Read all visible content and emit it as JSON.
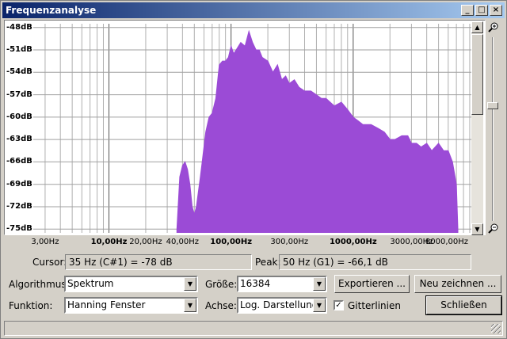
{
  "window": {
    "title": "Frequenzanalyse"
  },
  "titlebar_buttons": {
    "minimize": "_",
    "maximize": "□",
    "close": "×"
  },
  "colors": {
    "spectrum": "#9b4bd6",
    "title_start": "#0a246a",
    "title_end": "#a6caf0"
  },
  "plot": {
    "y_ticks": [
      "-48dB",
      "-51dB",
      "-54dB",
      "-57dB",
      "-60dB",
      "-63dB",
      "-66dB",
      "-69dB",
      "-72dB",
      "-75dB"
    ],
    "x_ticks": [
      {
        "label": "3,00Hz",
        "bold": false
      },
      {
        "label": "10,00Hz",
        "bold": true
      },
      {
        "label": "20,00Hz",
        "bold": false
      },
      {
        "label": "40,00Hz",
        "bold": false
      },
      {
        "label": "100,00Hz",
        "bold": true
      },
      {
        "label": "300,00Hz",
        "bold": false
      },
      {
        "label": "1000,00Hz",
        "bold": true
      },
      {
        "label": "3000,00Hz",
        "bold": false
      },
      {
        "label": "8000,00Hz",
        "bold": false
      }
    ]
  },
  "chart_data": {
    "type": "area",
    "x_scale": "log",
    "xlim": [
      2.4,
      10000
    ],
    "ylim": [
      -75.5,
      -47.5
    ],
    "grid": true,
    "x": [
      36,
      38,
      40,
      42,
      44,
      46,
      48,
      50,
      52,
      54,
      56,
      58,
      62,
      66,
      70,
      75,
      80,
      85,
      90,
      95,
      100,
      105,
      110,
      120,
      130,
      140,
      150,
      160,
      170,
      180,
      200,
      220,
      240,
      260,
      280,
      300,
      330,
      360,
      400,
      450,
      500,
      550,
      600,
      700,
      800,
      900,
      1000,
      1100,
      1200,
      1400,
      1600,
      1800,
      2000,
      2200,
      2500,
      2800,
      3000,
      3300,
      3600,
      4000,
      4400,
      5000,
      5500,
      6000,
      6500,
      7000,
      7200
    ],
    "values": [
      -75,
      -68,
      -66.5,
      -66,
      -67,
      -69,
      -72,
      -73,
      -72,
      -70,
      -68,
      -66,
      -62,
      -60,
      -59.5,
      -57.5,
      -53,
      -52.5,
      -52.5,
      -52,
      -50.5,
      -51.5,
      -51,
      -50,
      -50.5,
      -48.5,
      -50,
      -51,
      -51,
      -52,
      -52.5,
      -54,
      -53,
      -55,
      -54.5,
      -55.5,
      -55,
      -56,
      -56.5,
      -56.5,
      -57,
      -57.5,
      -57.5,
      -58.5,
      -58,
      -59,
      -60,
      -60.5,
      -61,
      -61,
      -61.5,
      -62,
      -63,
      -63,
      -62.5,
      -62.5,
      -63.5,
      -63.5,
      -64,
      -63.5,
      -64.5,
      -63.5,
      -64.5,
      -64.5,
      -66,
      -69,
      -75
    ]
  },
  "cursor": {
    "label": "Cursor:",
    "value": "35 Hz (C#1) = -78 dB"
  },
  "peak": {
    "label": "Peak:",
    "value": "50 Hz (G1) = -66,1 dB"
  },
  "algorithm": {
    "label": "Algorithmus:",
    "value": "Spektrum"
  },
  "size": {
    "label": "Größe:",
    "value": "16384"
  },
  "function": {
    "label": "Funktion:",
    "value": "Hanning Fenster"
  },
  "axis": {
    "label": "Achse:",
    "value": "Log. Darstellung"
  },
  "gridlines": {
    "label": "Gitterlinien",
    "checked": "✓"
  },
  "buttons": {
    "export": "Exportieren ...",
    "redraw": "Neu zeichnen ...",
    "close": "Schließen"
  },
  "zoom": {
    "in_icon": "zoom-in-icon",
    "out_icon": "zoom-out-icon"
  }
}
